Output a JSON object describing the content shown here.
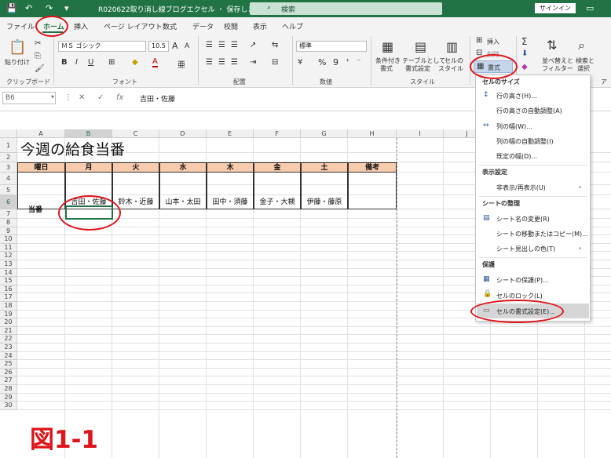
{
  "titlebar": {
    "title": "R020622取り消し線ブログエクセル ・ 保存しました",
    "search_placeholder": "検索",
    "signin_label": "サインイン",
    "icons": [
      "save-icon",
      "undo-icon",
      "redo-icon",
      "customize-icon"
    ]
  },
  "tabs": [
    "ファイル",
    "ホーム",
    "挿入",
    "ページ レイアウト",
    "数式",
    "データ",
    "校閲",
    "表示",
    "ヘルプ"
  ],
  "active_tab": "ホーム",
  "ribbon": {
    "clipboard": {
      "paste_label": "貼り付け",
      "group": "クリップボード"
    },
    "font": {
      "name": "ＭＳ ゴシック",
      "size": "10.5",
      "group": "フォント",
      "bold": "B",
      "italic": "I",
      "underline": "U",
      "grow": "A",
      "shrink": "A"
    },
    "alignment": {
      "group": "配置"
    },
    "number": {
      "format": "標準",
      "group": "数値",
      "percent": "%",
      "comma": "9"
    },
    "styles": {
      "conditional_label": "条件付き",
      "conditional_label2": "書式",
      "table_label": "テーブルとして",
      "table_label2": "書式設定",
      "cell_style_label": "セルの",
      "cell_style_label2": "スタイル",
      "group": "スタイル"
    },
    "cells": {
      "insert_label": "挿入",
      "delete_label": "削除",
      "format_label": "書式"
    },
    "editing": {
      "sort_label": "並べ替えと",
      "sort_label2": "フィルター",
      "find_label": "検索と",
      "find_label2": "選択",
      "sigma": "Σ"
    },
    "extra": "ア"
  },
  "formula_bar": {
    "cell_ref": "B6",
    "fx": "fx",
    "value": "吉田・佐藤"
  },
  "sheet": {
    "columns": [
      "A",
      "B",
      "C",
      "D",
      "E",
      "F",
      "G",
      "H",
      "I",
      "J"
    ],
    "rows": [
      "1",
      "2",
      "3",
      "4",
      "5",
      "6",
      "7",
      "8",
      "9",
      "10",
      "11",
      "12",
      "13",
      "14",
      "15",
      "16",
      "17",
      "18",
      "19",
      "20",
      "21",
      "22",
      "23",
      "24",
      "25",
      "26",
      "27",
      "28",
      "29",
      "30"
    ],
    "title": "今週の給食当番",
    "header": [
      "曜日",
      "月",
      "火",
      "水",
      "木",
      "金",
      "土",
      "備考"
    ],
    "row_label": "当番",
    "duty": [
      "吉田・佐藤",
      "鈴木・近藤",
      "山本・太田",
      "田中・須藤",
      "金子・大槻",
      "伊藤・藤原",
      ""
    ]
  },
  "format_menu": {
    "sections": [
      {
        "header": "セルのサイズ",
        "items": [
          "行の高さ(H)...",
          "行の高さの自動調整(A)",
          "列の幅(W)...",
          "列の幅の自動調整(I)",
          "既定の幅(D)..."
        ]
      },
      {
        "header": "表示設定",
        "items": [
          "非表示/再表示(U)"
        ]
      },
      {
        "header": "シートの整理",
        "items": [
          "シート名の変更(R)",
          "シートの移動またはコピー(M)...",
          "シート見出しの色(T)"
        ]
      },
      {
        "header": "保護",
        "items": [
          "シートの保護(P)...",
          "セルのロック(L)",
          "セルの書式設定(E)..."
        ]
      }
    ]
  },
  "figure_label": "図1-1",
  "colors": {
    "excel_green": "#217346",
    "header_fill": "#f8cbad",
    "annotation_red": "#e0141a"
  }
}
